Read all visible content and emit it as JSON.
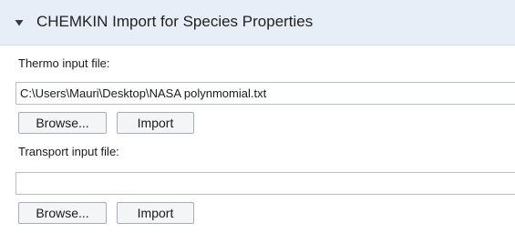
{
  "section": {
    "title": "CHEMKIN Import for Species Properties",
    "expanded": true,
    "icon": "chevron-down-icon",
    "header_color": "#e8eef8"
  },
  "thermo": {
    "label": "Thermo input file:",
    "value": "C:\\Users\\Mauri\\Desktop\\NASA polynmomial.txt",
    "browse_label": "Browse...",
    "import_label": "Import"
  },
  "transport": {
    "label": "Transport input file:",
    "value": "",
    "browse_label": "Browse...",
    "import_label": "Import"
  }
}
